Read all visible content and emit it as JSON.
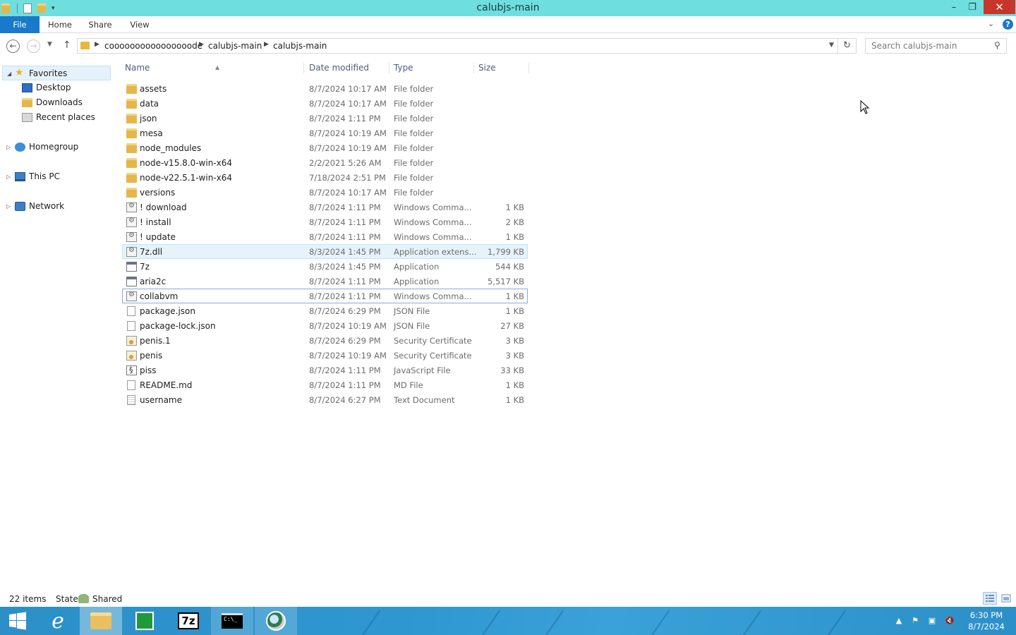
{
  "window": {
    "title": "calubjs-main"
  },
  "ribbon": {
    "tabs": [
      "File",
      "Home",
      "Share",
      "View"
    ]
  },
  "address": {
    "crumbs": [
      "coooooooooooooooode",
      "calubjs-main",
      "calubjs-main"
    ]
  },
  "search": {
    "placeholder": "Search calubjs-main"
  },
  "nav": {
    "favorites": "Favorites",
    "desktop": "Desktop",
    "downloads": "Downloads",
    "recent": "Recent places",
    "homegroup": "Homegroup",
    "thispc": "This PC",
    "network": "Network"
  },
  "columns": {
    "name": "Name",
    "date": "Date modified",
    "type": "Type",
    "size": "Size"
  },
  "files": [
    {
      "name": "assets",
      "date": "8/7/2024 10:17 AM",
      "type": "File folder",
      "size": "",
      "icon": "folder-icon"
    },
    {
      "name": "data",
      "date": "8/7/2024 10:17 AM",
      "type": "File folder",
      "size": "",
      "icon": "folder-icon"
    },
    {
      "name": "json",
      "date": "8/7/2024 1:11 PM",
      "type": "File folder",
      "size": "",
      "icon": "folder-icon"
    },
    {
      "name": "mesa",
      "date": "8/7/2024 10:19 AM",
      "type": "File folder",
      "size": "",
      "icon": "folder-icon"
    },
    {
      "name": "node_modules",
      "date": "8/7/2024 10:19 AM",
      "type": "File folder",
      "size": "",
      "icon": "folder-icon"
    },
    {
      "name": "node-v15.8.0-win-x64",
      "date": "2/2/2021 5:26 AM",
      "type": "File folder",
      "size": "",
      "icon": "folder-icon"
    },
    {
      "name": "node-v22.5.1-win-x64",
      "date": "7/18/2024 2:51 PM",
      "type": "File folder",
      "size": "",
      "icon": "folder-icon"
    },
    {
      "name": "versions",
      "date": "8/7/2024 10:17 AM",
      "type": "File folder",
      "size": "",
      "icon": "folder-icon"
    },
    {
      "name": "! download",
      "date": "8/7/2024 1:11 PM",
      "type": "Windows Comma...",
      "size": "1 KB",
      "icon": "batch-file-icon"
    },
    {
      "name": "! install",
      "date": "8/7/2024 1:11 PM",
      "type": "Windows Comma...",
      "size": "2 KB",
      "icon": "batch-file-icon"
    },
    {
      "name": "! update",
      "date": "8/7/2024 1:11 PM",
      "type": "Windows Comma...",
      "size": "1 KB",
      "icon": "batch-file-icon"
    },
    {
      "name": "7z.dll",
      "date": "8/3/2024 1:45 PM",
      "type": "Application extens...",
      "size": "1,799 KB",
      "icon": "dll-icon",
      "state": "hover"
    },
    {
      "name": "7z",
      "date": "8/3/2024 1:45 PM",
      "type": "Application",
      "size": "544 KB",
      "icon": "application-icon"
    },
    {
      "name": "aria2c",
      "date": "8/7/2024 1:11 PM",
      "type": "Application",
      "size": "5,517 KB",
      "icon": "application-icon"
    },
    {
      "name": "collabvm",
      "date": "8/7/2024 1:11 PM",
      "type": "Windows Comma...",
      "size": "1 KB",
      "icon": "batch-file-icon",
      "state": "focus"
    },
    {
      "name": "package.json",
      "date": "8/7/2024 6:29 PM",
      "type": "JSON File",
      "size": "1 KB",
      "icon": "blank-file-icon"
    },
    {
      "name": "package-lock.json",
      "date": "8/7/2024 10:19 AM",
      "type": "JSON File",
      "size": "27 KB",
      "icon": "blank-file-icon"
    },
    {
      "name": "penis.1",
      "date": "8/7/2024 6:29 PM",
      "type": "Security Certificate",
      "size": "3 KB",
      "icon": "certificate-icon"
    },
    {
      "name": "penis",
      "date": "8/7/2024 10:19 AM",
      "type": "Security Certificate",
      "size": "3 KB",
      "icon": "certificate-icon"
    },
    {
      "name": "piss",
      "date": "8/7/2024 1:11 PM",
      "type": "JavaScript File",
      "size": "33 KB",
      "icon": "script-file-icon"
    },
    {
      "name": "README.md",
      "date": "8/7/2024 1:11 PM",
      "type": "MD File",
      "size": "1 KB",
      "icon": "blank-file-icon"
    },
    {
      "name": "username",
      "date": "8/7/2024 6:27 PM",
      "type": "Text Document",
      "size": "1 KB",
      "icon": "text-file-icon"
    }
  ],
  "status": {
    "count": "22 items",
    "state_label": "State:",
    "state_value": "Shared"
  },
  "taskbar": {
    "apps": [
      "start-icon",
      "internet-explorer-icon",
      "file-explorer-icon",
      "store-icon",
      "7zip-icon",
      "command-prompt-icon",
      "network-app-icon"
    ],
    "clock_time": "6:30 PM",
    "clock_date": "8/7/2024"
  },
  "colors": {
    "titlebar": "#6fdede",
    "file_tab": "#1979ca",
    "close": "#c7362b",
    "taskbar": "#2f97d0",
    "folder": "#e5b64a"
  }
}
